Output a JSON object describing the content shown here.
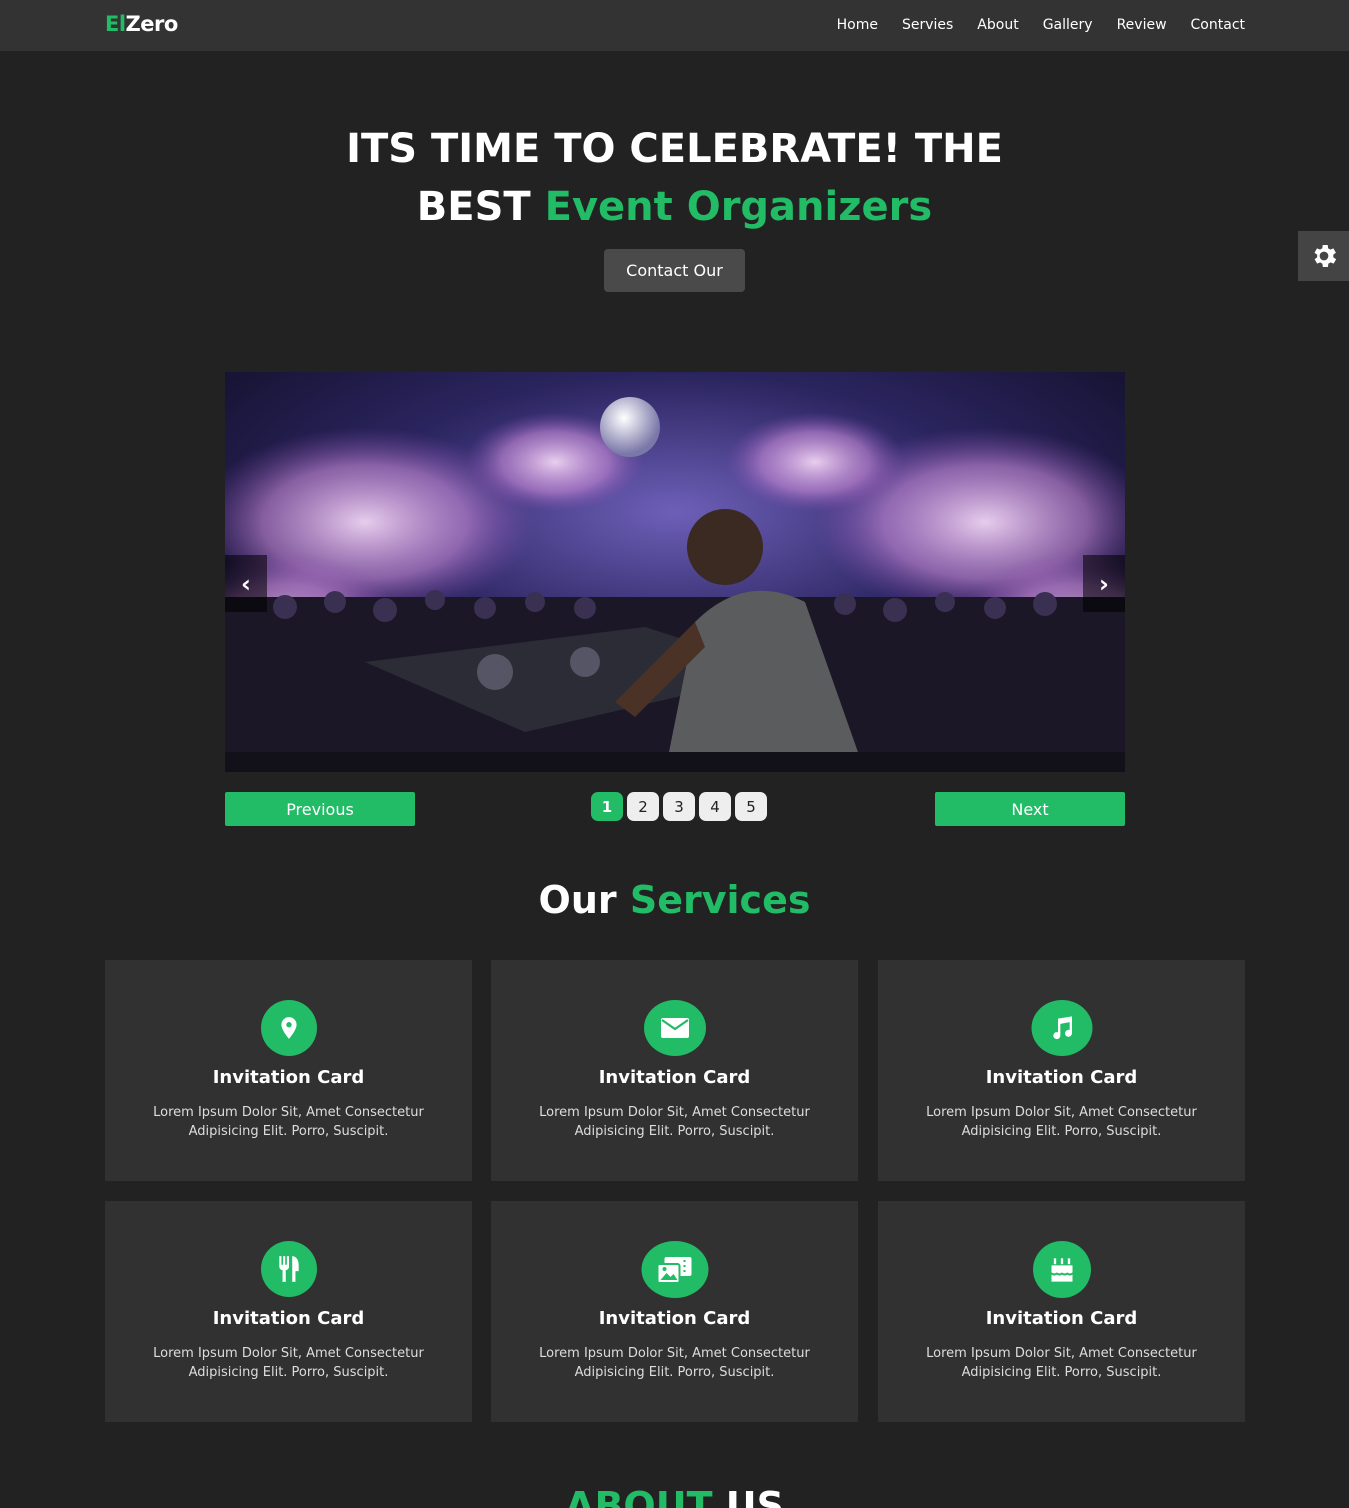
{
  "brand": {
    "prefix": "El",
    "suffix": "Zero",
    "accent": "#22bb66"
  },
  "nav": [
    "Home",
    "Servies",
    "About",
    "Gallery",
    "Review",
    "Contact"
  ],
  "hero": {
    "title_line1": "ITS TIME TO CELEBRATE! THE",
    "title_line2_plain": "BEST",
    "title_line2_accent": "Event Organizers",
    "button": "Contact Our"
  },
  "slider": {
    "prev_arrow": "‹",
    "next_arrow": "›",
    "previous_label": "Previous",
    "next_label": "Next",
    "pages": [
      "1",
      "2",
      "3",
      "4",
      "5"
    ],
    "active_page": "1"
  },
  "services": {
    "title_plain": "Our",
    "title_accent": "Services",
    "cards": [
      {
        "icon": "map-pin-icon",
        "title": "Invitation Card",
        "text": "Lorem Ipsum Dolor Sit, Amet Consectetur Adipisicing Elit. Porro, Suscipit."
      },
      {
        "icon": "envelope-icon",
        "title": "Invitation Card",
        "text": "Lorem Ipsum Dolor Sit, Amet Consectetur Adipisicing Elit. Porro, Suscipit."
      },
      {
        "icon": "music-icon",
        "title": "Invitation Card",
        "text": "Lorem Ipsum Dolor Sit, Amet Consectetur Adipisicing Elit. Porro, Suscipit."
      },
      {
        "icon": "utensils-icon",
        "title": "Invitation Card",
        "text": "Lorem Ipsum Dolor Sit, Amet Consectetur Adipisicing Elit. Porro, Suscipit."
      },
      {
        "icon": "photo-video-icon",
        "title": "Invitation Card",
        "text": "Lorem Ipsum Dolor Sit, Amet Consectetur Adipisicing Elit. Porro, Suscipit."
      },
      {
        "icon": "birthday-cake-icon",
        "title": "Invitation Card",
        "text": "Lorem Ipsum Dolor Sit, Amet Consectetur Adipisicing Elit. Porro, Suscipit."
      }
    ]
  },
  "about": {
    "title_accent": "ABOUT",
    "title_plain": "US"
  }
}
